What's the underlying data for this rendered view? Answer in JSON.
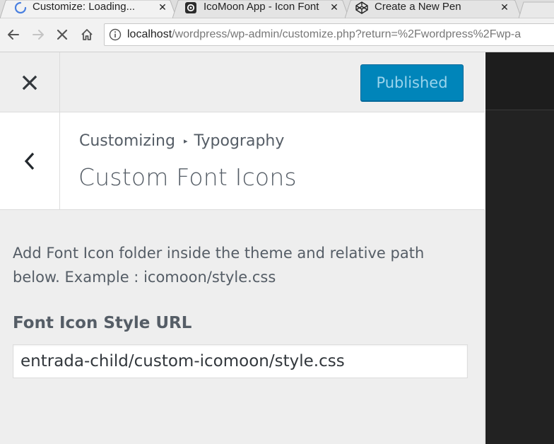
{
  "browser": {
    "tabs": [
      {
        "title": "Customize: Loading...",
        "icon": "loading-spinner-icon",
        "active": true
      },
      {
        "title": "IcoMoon App - Icon Font",
        "icon": "icomoon-icon",
        "active": false
      },
      {
        "title": "Create a New Pen",
        "icon": "codepen-icon",
        "active": false
      }
    ],
    "address": {
      "host": "localhost",
      "path": "/wordpress/wp-admin/customize.php?return=%2Fwordpress%2Fwp-a"
    }
  },
  "customizer": {
    "header": {
      "close_icon": "close-icon",
      "publish_label": "Published"
    },
    "section": {
      "breadcrumb_root": "Customizing",
      "breadcrumb_separator": "▸",
      "breadcrumb_current": "Typography",
      "title": "Custom Font Icons"
    },
    "description": "Add Font Icon folder inside the theme and relative path below. Example : icomoon/style.css",
    "field": {
      "label": "Font Icon Style URL",
      "value": "entrada-child/custom-icomoon/style.css"
    }
  },
  "colors": {
    "primary_button": "#0085ba",
    "panel_bg": "#eeeeee",
    "text": "#555d66",
    "preview_bg": "#222222"
  }
}
